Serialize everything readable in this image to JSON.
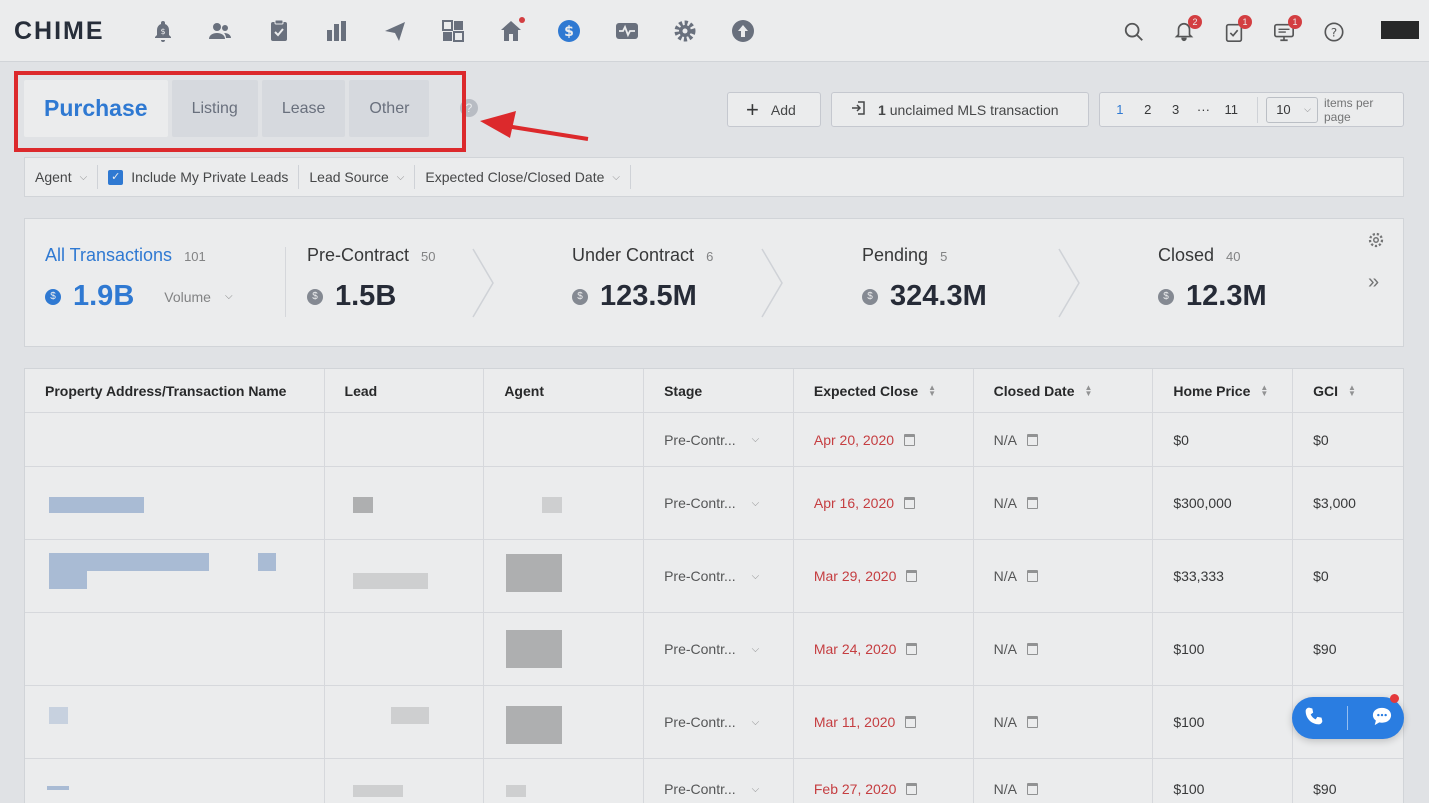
{
  "app": {
    "logo": "CHIME"
  },
  "nav_icons": [
    "bell-dollar-icon",
    "people-icon",
    "clipboard-icon",
    "bar-chart-icon",
    "paper-plane-icon",
    "dashboard-icon",
    "home-icon",
    "dollar-icon",
    "activity-icon",
    "gear-icon",
    "upload-icon"
  ],
  "right_nav": {
    "notifications_badge": "2",
    "tasks_badge": "1",
    "messages_badge": "1"
  },
  "tabs": [
    {
      "label": "Purchase",
      "active": true
    },
    {
      "label": "Listing"
    },
    {
      "label": "Lease"
    },
    {
      "label": "Other"
    }
  ],
  "help": "?",
  "toolbar": {
    "add_label": "Add",
    "mls_count": "1",
    "mls_label": "unclaimed MLS transaction"
  },
  "pager": {
    "pages": [
      "1",
      "2",
      "3",
      "···",
      "11"
    ],
    "current": "1",
    "per_page": "10",
    "per_page_label": "items per page"
  },
  "filters": {
    "agent": "Agent",
    "private_leads": "Include My Private Leads",
    "lead_source": "Lead Source",
    "close_date": "Expected Close/Closed Date"
  },
  "summary": {
    "all": {
      "name": "All Transactions",
      "count": "101",
      "amount": "1.9B",
      "volume_label": "Volume"
    },
    "pre_contract": {
      "name": "Pre-Contract",
      "count": "50",
      "amount": "1.5B"
    },
    "under_contract": {
      "name": "Under Contract",
      "count": "6",
      "amount": "123.5M"
    },
    "pending": {
      "name": "Pending",
      "count": "5",
      "amount": "324.3M"
    },
    "closed": {
      "name": "Closed",
      "count": "40",
      "amount": "12.3M"
    }
  },
  "table": {
    "headers": [
      "Property Address/Transaction Name",
      "Lead",
      "Agent",
      "Stage",
      "Expected Close",
      "Closed Date",
      "Home Price",
      "GCI"
    ],
    "rows": [
      {
        "stage": "Pre-Contr...",
        "expected": "Apr 20, 2020",
        "closed": "N/A",
        "price": "$0",
        "gci": "$0"
      },
      {
        "stage": "Pre-Contr...",
        "expected": "Apr 16, 2020",
        "closed": "N/A",
        "price": "$300,000",
        "gci": "$3,000"
      },
      {
        "stage": "Pre-Contr...",
        "expected": "Mar 29, 2020",
        "closed": "N/A",
        "price": "$33,333",
        "gci": "$0"
      },
      {
        "stage": "Pre-Contr...",
        "expected": "Mar 24, 2020",
        "closed": "N/A",
        "price": "$100",
        "gci": "$90"
      },
      {
        "stage": "Pre-Contr...",
        "expected": "Mar 11, 2020",
        "closed": "N/A",
        "price": "$100",
        "gci": ""
      },
      {
        "stage": "Pre-Contr...",
        "expected": "Feb 27, 2020",
        "closed": "N/A",
        "price": "$100",
        "gci": "$90"
      }
    ]
  },
  "colors": {
    "accent": "#2a7de1",
    "highlight": "#ee2224",
    "date_red": "#d4393c"
  }
}
